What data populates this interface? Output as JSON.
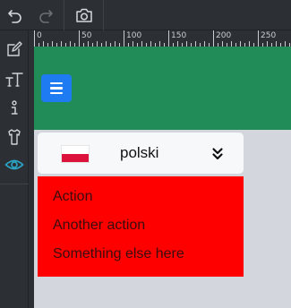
{
  "toolbar": {
    "undo_icon": "undo-icon",
    "redo_icon": "redo-icon",
    "screenshot_icon": "camera-icon"
  },
  "sidebar": {
    "items": [
      {
        "icon": "edit-icon"
      },
      {
        "icon": "text-icon"
      },
      {
        "icon": "info-icon"
      },
      {
        "icon": "shirt-icon"
      },
      {
        "icon": "eye-icon",
        "active": true
      }
    ]
  },
  "ruler": {
    "labels": [
      "0",
      "50",
      "100",
      "150",
      "200",
      "250"
    ]
  },
  "navbar": {
    "color": "#218c57",
    "toggler_color": "#1e7bf2"
  },
  "language": {
    "selected": "polski",
    "flag": "flag-poland"
  },
  "dropdown": {
    "color": "#ff0000",
    "items": [
      "Action",
      "Another action",
      "Something else here"
    ]
  }
}
